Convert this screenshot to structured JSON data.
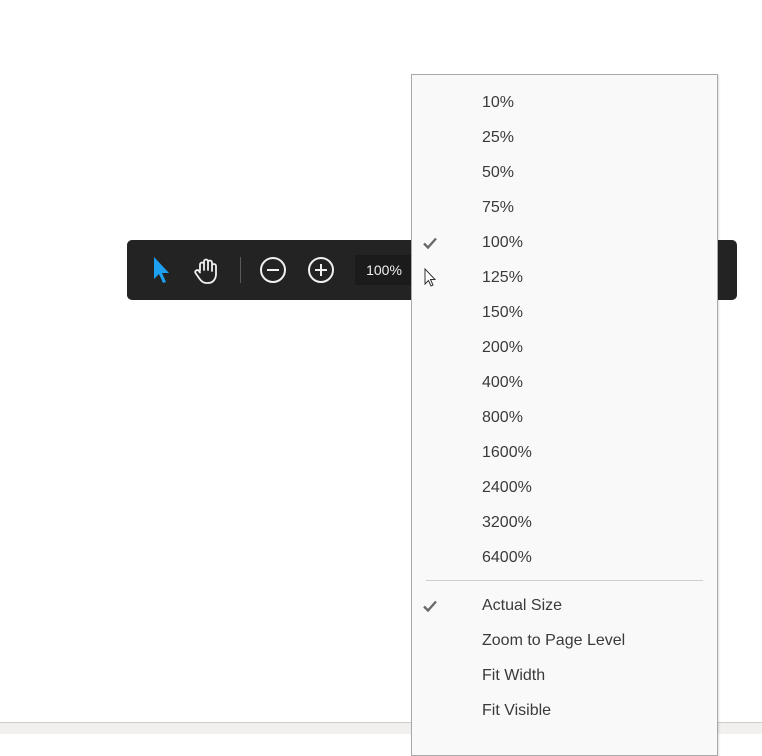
{
  "toolbar": {
    "zoom_value": "100%"
  },
  "zoom_menu": {
    "selected_zoom": "100%",
    "zoom_levels": [
      "10%",
      "25%",
      "50%",
      "75%",
      "100%",
      "125%",
      "150%",
      "200%",
      "400%",
      "800%",
      "1600%",
      "2400%",
      "3200%",
      "6400%"
    ],
    "fit_options": {
      "actual_size": "Actual Size",
      "zoom_to_page_level": "Zoom to Page Level",
      "fit_width": "Fit Width",
      "fit_visible": "Fit Visible"
    },
    "checked_fit_option": "Actual Size"
  },
  "colors": {
    "toolbar_bg": "#232323",
    "select_tool_accent": "#1ea0f0",
    "menu_bg": "#f9f9f9"
  }
}
